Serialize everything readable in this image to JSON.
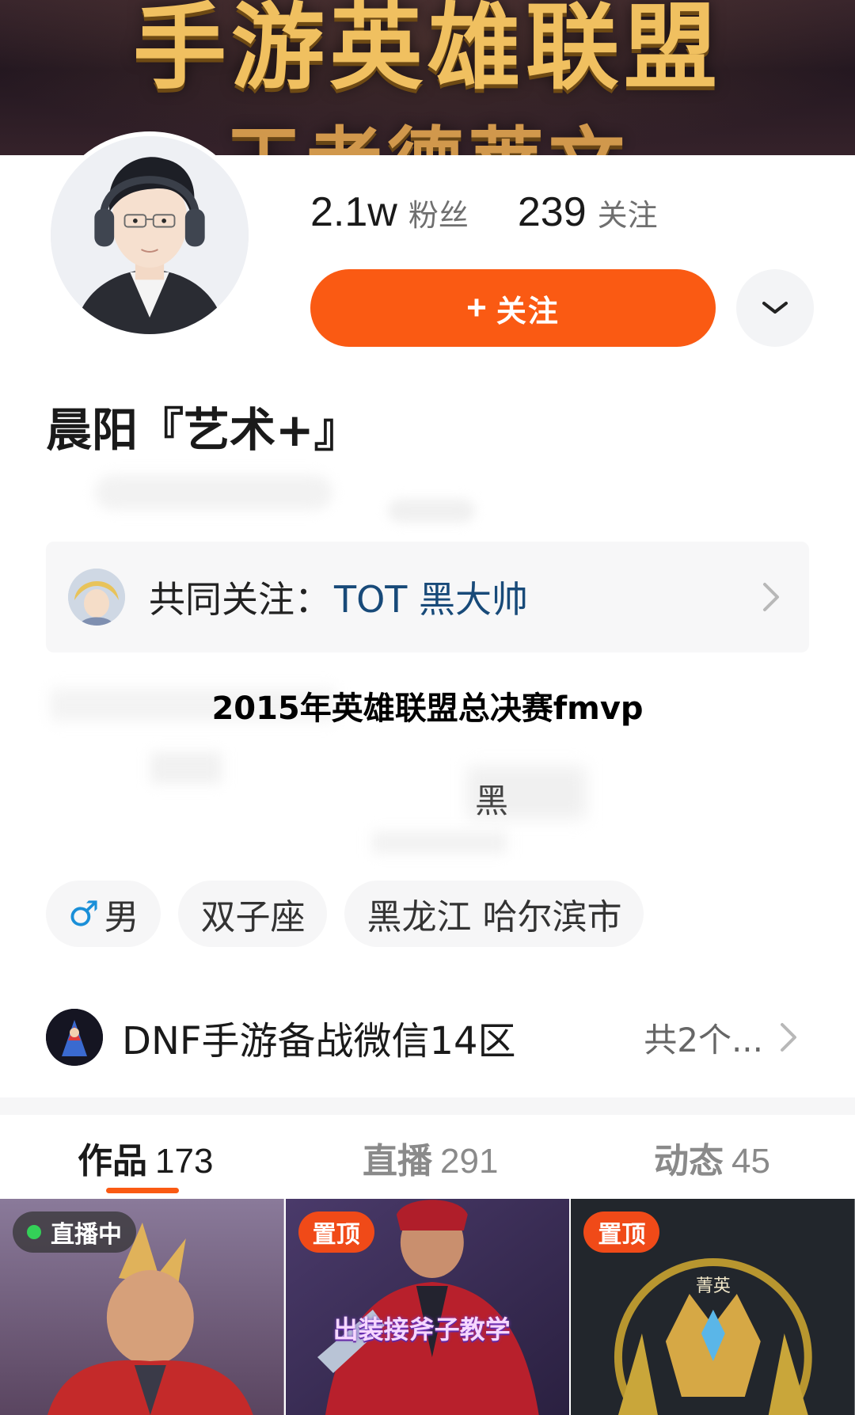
{
  "banner": {
    "line1": "手游英雄联盟",
    "line2": "王者德莱文"
  },
  "profile": {
    "followers_count": "2.1w",
    "followers_label": "粉丝",
    "following_count": "239",
    "following_label": "关注",
    "follow_button_icon": "+",
    "follow_button_label": "关注",
    "nickname": "晨阳『艺术+』"
  },
  "common_follow": {
    "label": "共同关注：",
    "name": "TOT 黑大帅"
  },
  "headline": "2015年英雄联盟总决赛fmvp",
  "fragment": "黑",
  "tags": [
    {
      "icon": "♂",
      "text": "男"
    },
    {
      "text": "双子座"
    },
    {
      "text": "黑龙江 哈尔滨市"
    }
  ],
  "group": {
    "name": "DNF手游备战微信14区",
    "count": "共2个..."
  },
  "tabs": [
    {
      "label": "作品",
      "count": "173"
    },
    {
      "label": "直播",
      "count": "291"
    },
    {
      "label": "动态",
      "count": "45"
    }
  ],
  "grid": [
    {
      "badge": "直播中"
    },
    {
      "badge": "置顶",
      "caption": "出装接斧子教学"
    },
    {
      "badge": "置顶",
      "label": "菁英"
    }
  ],
  "colors": {
    "accent": "#fa5a13",
    "link": "#184a79",
    "live_dot": "#34d058"
  }
}
